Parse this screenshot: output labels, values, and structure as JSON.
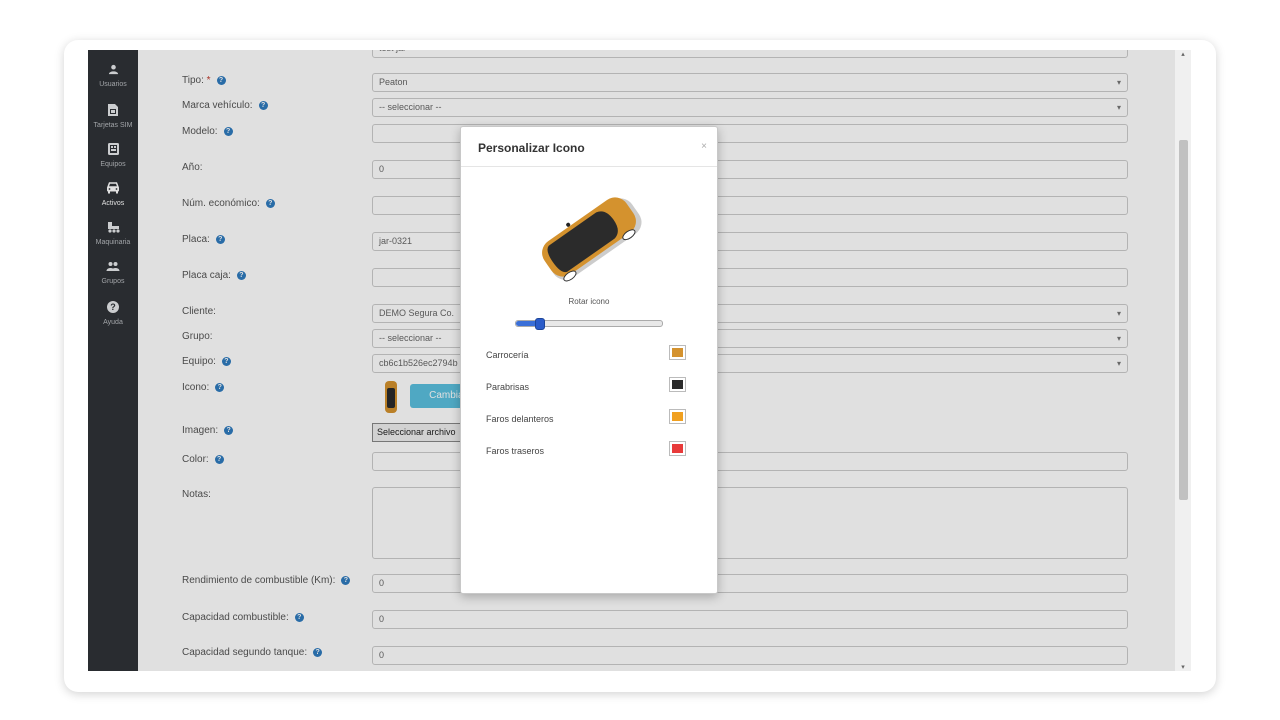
{
  "sidebar": {
    "items": [
      {
        "label": "Usuarios",
        "icon": "user-icon"
      },
      {
        "label": "Tarjetas SIM",
        "icon": "sim-card-icon"
      },
      {
        "label": "Equipos",
        "icon": "device-icon"
      },
      {
        "label": "Activos",
        "icon": "car-icon",
        "active": true
      },
      {
        "label": "Maquinaria",
        "icon": "machinery-icon"
      },
      {
        "label": "Grupos",
        "icon": "group-icon"
      },
      {
        "label": "Ayuda",
        "icon": "help-icon"
      }
    ]
  },
  "form": {
    "top_partial_value": "test jar",
    "tipo": {
      "label": "Tipo:",
      "required_mark": "*",
      "value": "Peaton"
    },
    "marca": {
      "label": "Marca vehículo:",
      "value": "-- seleccionar --"
    },
    "modelo": {
      "label": "Modelo:",
      "value": ""
    },
    "anio": {
      "label": "Año:",
      "value": "0"
    },
    "num_economico": {
      "label": "Núm. económico:",
      "value": ""
    },
    "placa": {
      "label": "Placa:",
      "value": "jar-0321"
    },
    "placa_caja": {
      "label": "Placa caja:",
      "value": ""
    },
    "cliente": {
      "label": "Cliente:",
      "value": "DEMO Segura Co."
    },
    "grupo": {
      "label": "Grupo:",
      "value": "-- seleccionar --"
    },
    "equipo": {
      "label": "Equipo:",
      "value": "cb6c1b526ec2794b"
    },
    "icono": {
      "label": "Icono:",
      "button": "Cambiar"
    },
    "imagen": {
      "label": "Imagen:",
      "button": "Seleccionar archivo"
    },
    "color": {
      "label": "Color:",
      "value": ""
    },
    "notas": {
      "label": "Notas:",
      "value": ""
    },
    "rendimiento": {
      "label": "Rendimiento de combustible (Km):",
      "value": "0"
    },
    "capacidad": {
      "label": "Capacidad combustible:",
      "value": "0"
    },
    "capacidad_segundo": {
      "label": "Capacidad segundo tanque:",
      "value": "0"
    }
  },
  "modal": {
    "title": "Personalizar Icono",
    "close": "×",
    "rotate_label": "Rotar icono",
    "rotation_fraction": 0.16,
    "colors": [
      {
        "label": "Carrocería",
        "color": "#d4922e"
      },
      {
        "label": "Parabrisas",
        "color": "#2b2b2b"
      },
      {
        "label": "Faros delanteros",
        "color": "#f0a020"
      },
      {
        "label": "Faros traseros",
        "color": "#e83a3a"
      }
    ]
  }
}
